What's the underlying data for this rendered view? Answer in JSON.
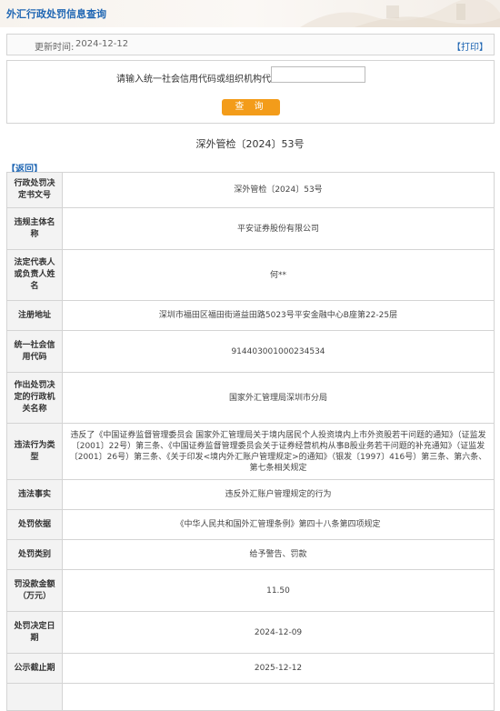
{
  "page": {
    "title": "外汇行政处罚信息查询",
    "update_label": "更新时间:",
    "update_value": "2024-12-12",
    "print_label": "【打印】"
  },
  "search": {
    "label": "请输入统一社会信用代码或组织机构代码:",
    "value": "",
    "placeholder": "",
    "button_label": "查 询"
  },
  "document": {
    "title": "深外管检〔2024〕53号",
    "back_label": "【返回】"
  },
  "detail_rows": [
    {
      "key": "行政处罚决定书文号",
      "value": "深外管检〔2024〕53号"
    },
    {
      "key": "违规主体名称",
      "value": "平安证券股份有限公司"
    },
    {
      "key": "法定代表人或负责人姓名",
      "value": "何**"
    },
    {
      "key": "注册地址",
      "value": "深圳市福田区福田街道益田路5023号平安金融中心B座第22-25层"
    },
    {
      "key": "统一社会信用代码",
      "value": "914403001000234534"
    },
    {
      "key": "作出处罚决定的行政机关名称",
      "value": "国家外汇管理局深圳市分局"
    },
    {
      "key": "违法行为类型",
      "value": "违反了《中国证券监督管理委员会 国家外汇管理局关于境内居民个人投资境内上市外资股若干问题的通知》（证监发〔2001〕22号）第三条、《中国证券监督管理委员会关于证券经营机构从事B股业务若干问题的补充通知》（证监发〔2001〕26号）第三条、《关于印发<境内外汇账户管理规定>的通知》（银发〔1997〕416号）第三条、第六条、第七条相关规定"
    },
    {
      "key": "违法事实",
      "value": "违反外汇账户管理规定的行为"
    },
    {
      "key": "处罚依据",
      "value": "《中华人民共和国外汇管理条例》第四十八条第四项规定"
    },
    {
      "key": "处罚类别",
      "value": "给予警告、罚款"
    },
    {
      "key": "罚没款金额（万元）",
      "value": "11.50"
    },
    {
      "key": "处罚决定日期",
      "value": "2024-12-09"
    },
    {
      "key": "公示截止期",
      "value": "2025-12-12"
    },
    {
      "key": "",
      "value": ""
    }
  ]
}
